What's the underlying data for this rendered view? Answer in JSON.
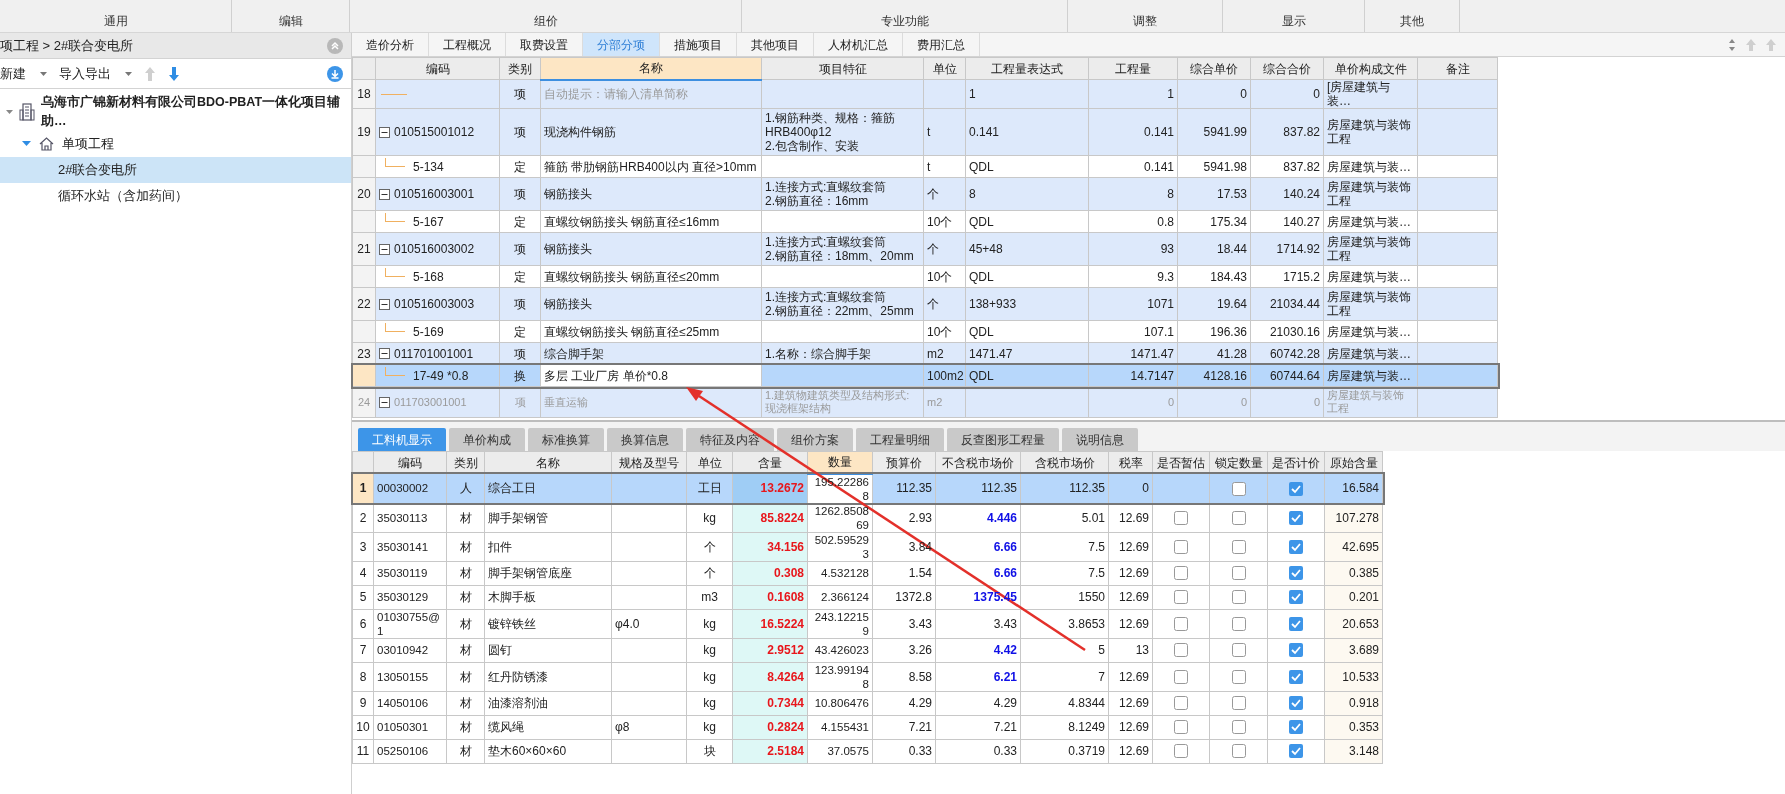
{
  "ribbon_groups": [
    "通用",
    "编辑",
    "组价",
    "专业功能",
    "调整",
    "显示",
    "其他"
  ],
  "breadcrumb": "项工程 > 2#联合变电所",
  "left_toolbar": {
    "new_menu": "新建",
    "import_export_menu": "导入导出"
  },
  "tree": {
    "label": "乌海市广锦新材料有限公司BDO-PBAT一体化项目辅助…",
    "children": [
      {
        "label": "单项工程",
        "expanded": true,
        "children": [
          {
            "label": "2#联合变电所",
            "selected": true
          },
          {
            "label": "循环水站（含加药间）",
            "selected": false
          }
        ]
      }
    ]
  },
  "main_tabs": [
    {
      "label": "造价分析",
      "selected": false
    },
    {
      "label": "工程概况",
      "selected": false
    },
    {
      "label": "取费设置",
      "selected": false
    },
    {
      "label": "分部分项",
      "selected": true
    },
    {
      "label": "措施项目",
      "selected": false
    },
    {
      "label": "其他项目",
      "selected": false
    },
    {
      "label": "人材机汇总",
      "selected": false
    },
    {
      "label": "费用汇总",
      "selected": false
    }
  ],
  "bill_table": {
    "columns": [
      "编码",
      "类别",
      "名称",
      "项目特征",
      "单位",
      "工程量表达式",
      "工程量",
      "综合单价",
      "综合合价",
      "单价构成文件",
      "备注"
    ],
    "rows": [
      {
        "kind": "item",
        "number": "18",
        "type": "项",
        "placeholder": "自动提示：请输入清单简称",
        "expression": "1",
        "quantity": "1",
        "unit_price": "0",
        "total": "0",
        "price_file": "[房屋建筑与装…",
        "selected": false,
        "disabled": false
      },
      {
        "kind": "item",
        "number": "19",
        "code": "010515001012",
        "expanded": true,
        "type": "项",
        "name": "现浇构件钢筋",
        "features": [
          "1.钢筋种类、规格：箍筋HRB400φ12",
          "2.包含制作、安装"
        ],
        "unit": "t",
        "expression": "0.141",
        "quantity": "0.141",
        "unit_price": "5941.99",
        "total": "837.82",
        "price_file": "房屋建筑与装饰工程",
        "selected": false,
        "disabled": false
      },
      {
        "kind": "quota",
        "code": "5-134",
        "type": "定",
        "name": "箍筋 带肋钢筋HRB400以内 直径>10mm",
        "unit": "t",
        "expression": "QDL",
        "quantity": "0.141",
        "unit_price": "5941.98",
        "total": "837.82",
        "price_file": "房屋建筑与装…",
        "selected": false,
        "disabled": false
      },
      {
        "kind": "item",
        "number": "20",
        "code": "010516003001",
        "expanded": true,
        "type": "项",
        "name": "钢筋接头",
        "features": [
          "1.连接方式:直螺纹套筒",
          "2.钢筋直径：16mm"
        ],
        "unit": "个",
        "expression": "8",
        "quantity": "8",
        "unit_price": "17.53",
        "total": "140.24",
        "price_file": "房屋建筑与装饰工程",
        "selected": false,
        "disabled": false
      },
      {
        "kind": "quota",
        "code": "5-167",
        "type": "定",
        "name": "直螺纹钢筋接头 钢筋直径≤16mm",
        "unit": "10个",
        "expression": "QDL",
        "quantity": "0.8",
        "unit_price": "175.34",
        "total": "140.27",
        "price_file": "房屋建筑与装…",
        "selected": false,
        "disabled": false
      },
      {
        "kind": "item",
        "number": "21",
        "code": "010516003002",
        "expanded": true,
        "type": "项",
        "name": "钢筋接头",
        "features": [
          "1.连接方式:直螺纹套筒",
          "2.钢筋直径：18mm、20mm"
        ],
        "unit": "个",
        "expression": "45+48",
        "quantity": "93",
        "unit_price": "18.44",
        "total": "1714.92",
        "price_file": "房屋建筑与装饰工程",
        "selected": false,
        "disabled": false
      },
      {
        "kind": "quota",
        "code": "5-168",
        "type": "定",
        "name": "直螺纹钢筋接头 钢筋直径≤20mm",
        "unit": "10个",
        "expression": "QDL",
        "quantity": "9.3",
        "unit_price": "184.43",
        "total": "1715.2",
        "price_file": "房屋建筑与装…",
        "selected": false,
        "disabled": false
      },
      {
        "kind": "item",
        "number": "22",
        "code": "010516003003",
        "expanded": true,
        "type": "项",
        "name": "钢筋接头",
        "features": [
          "1.连接方式:直螺纹套筒",
          "2.钢筋直径：22mm、25mm"
        ],
        "unit": "个",
        "expression": "138+933",
        "quantity": "1071",
        "unit_price": "19.64",
        "total": "21034.44",
        "price_file": "房屋建筑与装饰工程",
        "selected": false,
        "disabled": false
      },
      {
        "kind": "quota",
        "code": "5-169",
        "type": "定",
        "name": "直螺纹钢筋接头 钢筋直径≤25mm",
        "unit": "10个",
        "expression": "QDL",
        "quantity": "107.1",
        "unit_price": "196.36",
        "total": "21030.16",
        "price_file": "房屋建筑与装…",
        "selected": false,
        "disabled": false
      },
      {
        "kind": "item",
        "number": "23",
        "code": "011701001001",
        "expanded": true,
        "type": "项",
        "name": "综合脚手架",
        "features": [
          "1.名称：综合脚手架"
        ],
        "unit": "m2",
        "expression": "1471.47",
        "quantity": "1471.47",
        "unit_price": "41.28",
        "total": "60742.28",
        "price_file": "房屋建筑与装…",
        "selected": false,
        "disabled": false
      },
      {
        "kind": "quota",
        "code": "17-49 *0.8",
        "type": "换",
        "name": "多层 工业厂房  单价*0.8",
        "unit": "100m2",
        "expression": "QDL",
        "quantity": "14.7147",
        "unit_price": "4128.16",
        "total": "60744.64",
        "price_file": "房屋建筑与装…",
        "selected": true,
        "disabled": false
      },
      {
        "kind": "item",
        "number": "24",
        "code": "011703001001",
        "expanded": true,
        "type": "项",
        "name": "垂直运输",
        "features": [
          "1.建筑物建筑类型及结构形式:现浇框架结构"
        ],
        "unit": "m2",
        "quantity": "0",
        "unit_price": "0",
        "total": "0",
        "price_file": "房屋建筑与装饰工程",
        "selected": false,
        "disabled": true
      }
    ]
  },
  "detail_tabs": [
    {
      "label": "工料机显示",
      "selected": true
    },
    {
      "label": "单价构成",
      "selected": false
    },
    {
      "label": "标准换算",
      "selected": false
    },
    {
      "label": "换算信息",
      "selected": false
    },
    {
      "label": "特征及内容",
      "selected": false
    },
    {
      "label": "组价方案",
      "selected": false
    },
    {
      "label": "工程量明细",
      "selected": false
    },
    {
      "label": "反查图形工程量",
      "selected": false
    },
    {
      "label": "说明信息",
      "selected": false
    }
  ],
  "resource_table": {
    "columns": [
      "编码",
      "类别",
      "名称",
      "规格及型号",
      "单位",
      "含量",
      "数量",
      "预算价",
      "不含税市场价",
      "含税市场价",
      "税率",
      "是否暂估",
      "锁定数量",
      "是否计价",
      "原始含量"
    ],
    "rows": [
      {
        "number": "1",
        "code": "00030002",
        "type": "人",
        "name": "综合工日",
        "unit": "工日",
        "content": "13.2672",
        "quantity": "195.222868",
        "budget_price": "112.35",
        "market_price": "112.35",
        "market_price_changed": false,
        "tax_price": "112.35",
        "tax_rate": "0",
        "locked": false,
        "priced": true,
        "original_content": "16.584",
        "selected": true
      },
      {
        "number": "2",
        "code": "35030113",
        "type": "材",
        "name": "脚手架钢管",
        "unit": "kg",
        "content": "85.8224",
        "quantity": "1262.850869",
        "budget_price": "2.93",
        "market_price": "4.446",
        "market_price_changed": true,
        "tax_price": "5.01",
        "tax_rate": "12.69",
        "provisional": false,
        "locked": false,
        "priced": true,
        "original_content": "107.278",
        "selected": false
      },
      {
        "number": "3",
        "code": "35030141",
        "type": "材",
        "name": "扣件",
        "unit": "个",
        "content": "34.156",
        "quantity": "502.595293",
        "budget_price": "3.84",
        "market_price": "6.66",
        "market_price_changed": true,
        "tax_price": "7.5",
        "tax_rate": "12.69",
        "provisional": false,
        "locked": false,
        "priced": true,
        "original_content": "42.695",
        "selected": false
      },
      {
        "number": "4",
        "code": "35030119",
        "type": "材",
        "name": "脚手架钢管底座",
        "unit": "个",
        "content": "0.308",
        "quantity": "4.532128",
        "budget_price": "1.54",
        "market_price": "6.66",
        "market_price_changed": true,
        "tax_price": "7.5",
        "tax_rate": "12.69",
        "provisional": false,
        "locked": false,
        "priced": true,
        "original_content": "0.385",
        "selected": false
      },
      {
        "number": "5",
        "code": "35030129",
        "type": "材",
        "name": "木脚手板",
        "unit": "m3",
        "content": "0.1608",
        "quantity": "2.366124",
        "budget_price": "1372.8",
        "market_price": "1375.45",
        "market_price_changed": true,
        "tax_price": "1550",
        "tax_rate": "12.69",
        "provisional": false,
        "locked": false,
        "priced": true,
        "original_content": "0.201",
        "selected": false
      },
      {
        "number": "6",
        "code": "01030755@1",
        "type": "材",
        "name": "镀锌铁丝",
        "spec": "φ4.0",
        "unit": "kg",
        "content": "16.5224",
        "quantity": "243.122159",
        "budget_price": "3.43",
        "market_price": "3.43",
        "market_price_changed": false,
        "tax_price": "3.8653",
        "tax_rate": "12.69",
        "provisional": false,
        "locked": false,
        "priced": true,
        "original_content": "20.653",
        "selected": false
      },
      {
        "number": "7",
        "code": "03010942",
        "type": "材",
        "name": "圆钉",
        "unit": "kg",
        "content": "2.9512",
        "quantity": "43.426023",
        "budget_price": "3.26",
        "market_price": "4.42",
        "market_price_changed": true,
        "tax_price": "5",
        "tax_rate": "13",
        "provisional": false,
        "locked": false,
        "priced": true,
        "original_content": "3.689",
        "selected": false
      },
      {
        "number": "8",
        "code": "13050155",
        "type": "材",
        "name": "红丹防锈漆",
        "unit": "kg",
        "content": "8.4264",
        "quantity": "123.991948",
        "budget_price": "8.58",
        "market_price": "6.21",
        "market_price_changed": true,
        "tax_price": "7",
        "tax_rate": "12.69",
        "provisional": false,
        "locked": false,
        "priced": true,
        "original_content": "10.533",
        "selected": false
      },
      {
        "number": "9",
        "code": "14050106",
        "type": "材",
        "name": "油漆溶剂油",
        "unit": "kg",
        "content": "0.7344",
        "quantity": "10.806476",
        "budget_price": "4.29",
        "market_price": "4.29",
        "market_price_changed": false,
        "tax_price": "4.8344",
        "tax_rate": "12.69",
        "provisional": false,
        "locked": false,
        "priced": true,
        "original_content": "0.918",
        "selected": false
      },
      {
        "number": "10",
        "code": "01050301",
        "type": "材",
        "name": "缆风绳",
        "spec": "φ8",
        "unit": "kg",
        "content": "0.2824",
        "quantity": "4.155431",
        "budget_price": "7.21",
        "market_price": "7.21",
        "market_price_changed": false,
        "tax_price": "8.1249",
        "tax_rate": "12.69",
        "provisional": false,
        "locked": false,
        "priced": true,
        "original_content": "0.353",
        "selected": false
      },
      {
        "number": "11",
        "code": "05250106",
        "type": "材",
        "name": "垫木60×60×60",
        "unit": "块",
        "content": "2.5184",
        "quantity": "37.0575",
        "budget_price": "0.33",
        "market_price": "0.33",
        "market_price_changed": false,
        "tax_price": "0.3719",
        "tax_rate": "12.69",
        "provisional": false,
        "locked": false,
        "priced": true,
        "original_content": "3.148",
        "selected": false
      }
    ]
  }
}
